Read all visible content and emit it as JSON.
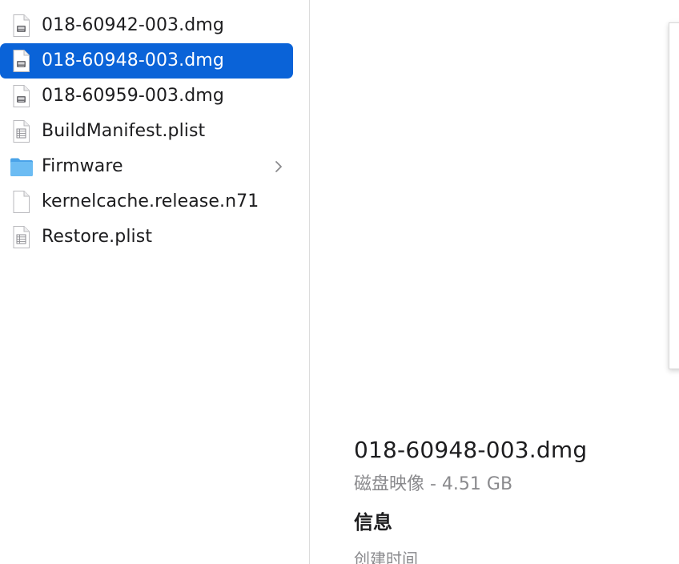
{
  "column": {
    "items": [
      {
        "label": "018-60942-003.dmg",
        "icon": "disk-image-icon",
        "selected": false,
        "folder": false
      },
      {
        "label": "018-60948-003.dmg",
        "icon": "disk-image-icon",
        "selected": true,
        "folder": false
      },
      {
        "label": "018-60959-003.dmg",
        "icon": "disk-image-icon",
        "selected": false,
        "folder": false
      },
      {
        "label": "BuildManifest.plist",
        "icon": "plist-file-icon",
        "selected": false,
        "folder": false
      },
      {
        "label": "Firmware",
        "icon": "folder-icon",
        "selected": false,
        "folder": true
      },
      {
        "label": "kernelcache.release.n71",
        "icon": "document-icon",
        "selected": false,
        "folder": false
      },
      {
        "label": "Restore.plist",
        "icon": "plist-file-icon",
        "selected": false,
        "folder": false
      }
    ]
  },
  "preview": {
    "title": "018-60948-003.dmg",
    "subtitle": "磁盘映像 - 4.51 GB",
    "section_title": "信息",
    "field_created": "创建时间"
  },
  "colors": {
    "selection": "#0a63d8",
    "text": "#1d1d1f",
    "secondary_text": "#8a8a8d",
    "folder": "#5fb2ee"
  }
}
